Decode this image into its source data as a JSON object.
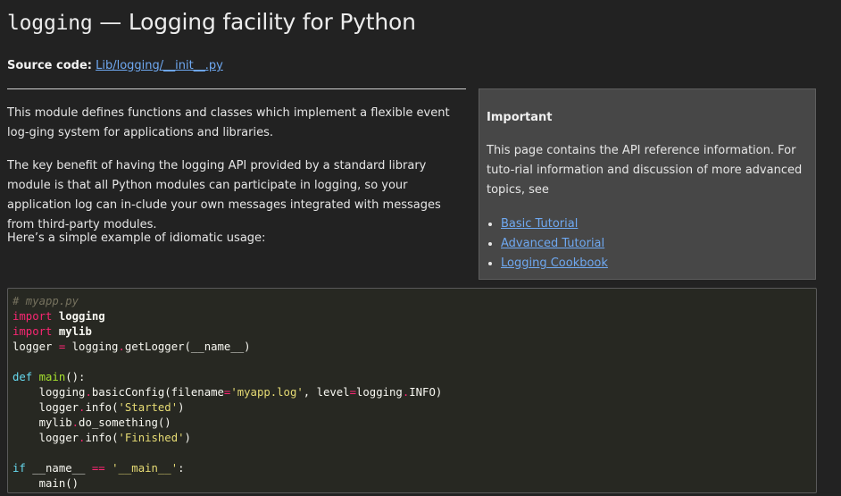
{
  "page": {
    "title_code": "logging",
    "title_rest": " — Logging facility for Python",
    "source_label": "Source code:",
    "source_link": "Lib/logging/__init__.py"
  },
  "paragraphs": [
    "This module defines functions and classes which implement a flexible event log-ging system for applications and libraries.",
    "The key benefit of having the logging API provided by a standard library module is that all Python modules can participate in logging, so your application log can in-clude your own messages integrated with messages from third-party modules.",
    "Here’s a simple example of idiomatic usage:"
  ],
  "admonition": {
    "title": "Important",
    "text": "This page contains the API reference information. For tuto-rial information and discussion of more advanced topics, see",
    "links": [
      "Basic Tutorial",
      "Advanced Tutorial",
      "Logging Cookbook"
    ]
  },
  "code": {
    "comment": "# myapp.py",
    "kw_import": "import",
    "mod_logging": "logging",
    "mod_mylib": "mylib",
    "kw_def": "def",
    "fn_main": "main",
    "kw_if": "if",
    "str_log": "'myapp.log'",
    "str_started": "'Started'",
    "str_finished": "'Finished'",
    "str_main": "'__main__'"
  },
  "colors": {
    "background": "#222222",
    "link": "#6fa9f2",
    "code_background": "#272822",
    "admonition_background": "#474747"
  }
}
